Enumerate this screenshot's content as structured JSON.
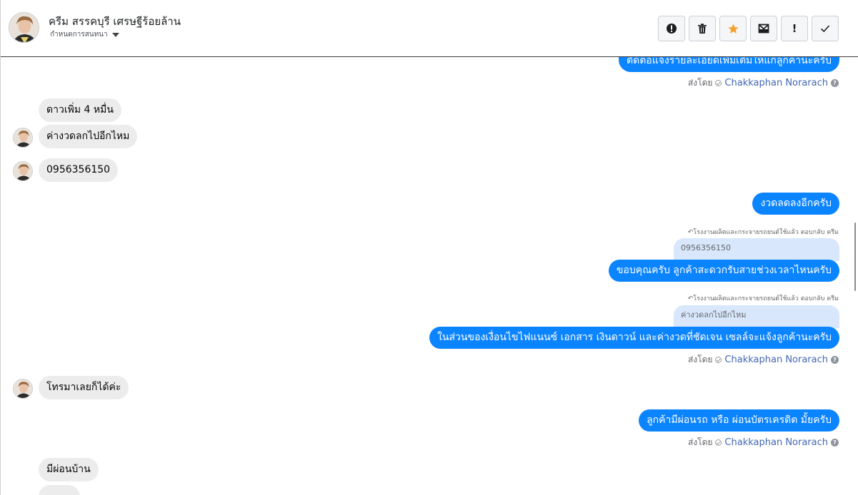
{
  "header": {
    "name": "ครีม สรรคบุรี เศรษฐีร้อยล้าน",
    "subtitle": "กำหนดการสนทนา",
    "tools": [
      {
        "name": "alert-icon"
      },
      {
        "name": "trash-icon"
      },
      {
        "name": "star-icon"
      },
      {
        "name": "mail-icon"
      },
      {
        "name": "exclamation-icon",
        "label": "!"
      },
      {
        "name": "check-icon"
      }
    ]
  },
  "colors": {
    "outgoing": "#0b84ff",
    "incoming": "#ececec",
    "quoted": "#d8e7fb",
    "star": "#f6a02d",
    "link": "#4267b2"
  },
  "messages": {
    "m1_text": "ติดต่อแจ้งรายละเอียดเพิ่มเติมให้แก่ลูกค้านะครับ",
    "sent_by_label": "ส่งโดย",
    "sender": "Chakkaphan Norarach",
    "m2_text": "ดาวเพิ่ม 4 หมื่น",
    "m3_text": "ค่างวดลกไปอีกไหม",
    "m4_text": "0956356150",
    "m5_text": "งวดลดลงอีกครับ",
    "reply_note": "โรงงานผลิตและกระจายรถยนต์ใช้แล้ว ตอบกลับ ครีม",
    "q1_text": "0956356150",
    "m6_text": "ขอบคุณครับ ลูกค้าสะดวกรับสายช่วงเวลาไหนครับ",
    "q2_text": "ค่างวดลกไปอีกไหม",
    "m7_text": "ในส่วนของเงื่อนไขไฟแนนซ์ เอกสาร เงินดาวน์ และค่างวดที่ชัดเจน เซลล์จะแจ้งลูกค้านะครับ",
    "m8_text": "โทรมาเลยก็ได้ค่ะ",
    "m9_text": "ลูกค้ามีผ่อนรถ หรือ ผ่อนบัตรเครดิต มั้ยครับ",
    "m10_text": "มีผ่อนบ้าน"
  }
}
